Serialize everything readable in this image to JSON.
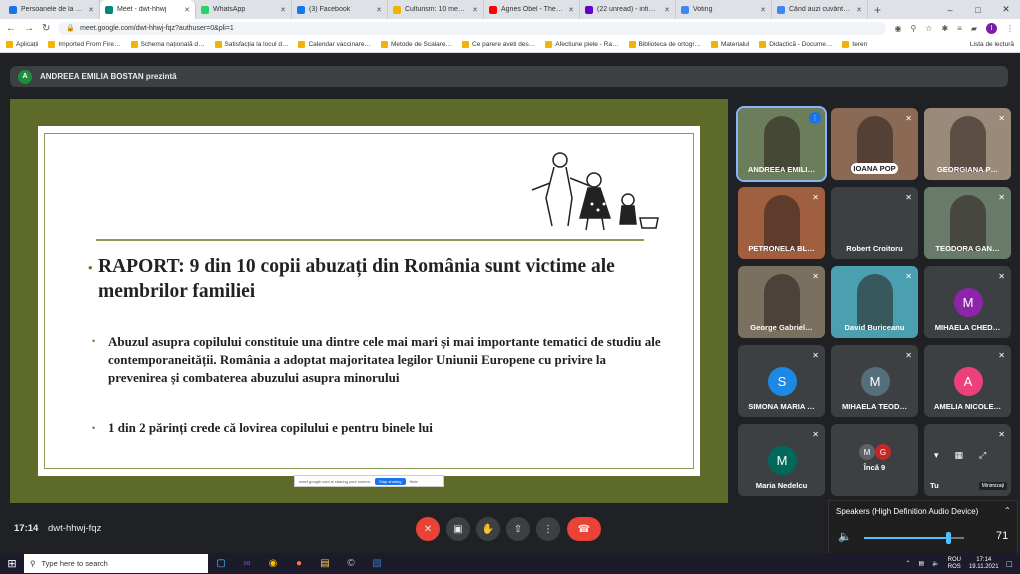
{
  "browser": {
    "tabs": [
      {
        "title": "Persoanele de la EDU…",
        "color": "#1a73e8"
      },
      {
        "title": "Meet - dwt-hhwj",
        "color": "#00897b",
        "active": true
      },
      {
        "title": "WhatsApp",
        "color": "#25d366"
      },
      {
        "title": "(3) Facebook",
        "color": "#1877f2"
      },
      {
        "title": "Culturism: 10 medali…",
        "color": "#f2b400"
      },
      {
        "title": "Agnes Obel - The Cu…",
        "color": "#ff0000"
      },
      {
        "title": "(22 unread) - infimoll…",
        "color": "#6001d2"
      },
      {
        "title": "Voting",
        "color": "#4285f4"
      },
      {
        "title": "Când auzi cuvântul vi…",
        "color": "#4285f4"
      }
    ],
    "url": "meet.google.com/dwt-hhwj-fqz?authuser=0&pli=1",
    "bookmarks": [
      "Aplicații",
      "Imported From Fire…",
      "Schema națională d…",
      "Satisfacția la locul d…",
      "Calendar vaccinare…",
      "Metode de Scalare…",
      "Ce parere aveti des…",
      "Afectiune piele - Ra…",
      "Biblioteca de ortogr…",
      "Materialul",
      "Didactică - Docume…",
      "teren"
    ],
    "reading_list": "Lista de lectură",
    "profile_letter": "I"
  },
  "meet": {
    "presenter_initial": "A",
    "presenter": "ANDREEA EMILIA BOSTAN prezintă",
    "time": "17:14",
    "code": "dwt-hhwj-fqz",
    "sharing_notice": "meet.google.com is sharing your screen.",
    "stop_sharing": "Stop sharing",
    "hide": "Hide"
  },
  "slide": {
    "title": "RAPORT: 9 din 10 copii abuzați din România sunt victime ale membrilor familiei",
    "bullet1": "Abuzul asupra copilului constituie una dintre cele mai mari și mai importante tematici de studiu ale contemporaneității. România a adoptat majoritatea legilor Uniunii Europene cu privire la prevenirea și combaterea abuzului asupra minorului",
    "bullet2": "1 din 2 părinți crede că lovirea copilului e pentru binele lui"
  },
  "participants": [
    {
      "name": "ANDREEA EMILI…",
      "bg": "#6b7d5a",
      "video": true
    },
    {
      "name": "IOANA POP",
      "bg": "#8a6a55",
      "video": true
    },
    {
      "name": "GEORGIANA P…",
      "bg": "#9a8a7a",
      "video": true
    },
    {
      "name": "PETRONELA BL…",
      "bg": "#a06040",
      "video": true
    },
    {
      "name": "Robert Croitoru",
      "bg": "#3c4043",
      "video": false
    },
    {
      "name": "TEODORA GAN…",
      "bg": "#6a7a6a",
      "video": true
    },
    {
      "name": "George Gabriel…",
      "bg": "#7a7060",
      "video": true
    },
    {
      "name": "David Buriceanu",
      "bg": "#4aa0b0",
      "video": true
    },
    {
      "name": "MIHAELA CHED…",
      "initial": "M",
      "avatar": "#8e24aa"
    },
    {
      "name": "SIMONA MARIA …",
      "initial": "S",
      "avatar": "#1e88e5"
    },
    {
      "name": "MIHAELA TEOD…",
      "initial": "M",
      "avatar": "#546e7a"
    },
    {
      "name": "AMELIA NICOLE…",
      "initial": "A",
      "avatar": "#ec407a"
    },
    {
      "name": "Maria Nedelcu",
      "initial": "M",
      "avatar": "#00695c"
    },
    {
      "name": "Încă 9",
      "initials": [
        "M",
        "G"
      ]
    },
    {
      "name": "Tu",
      "extra": "Minimizați"
    }
  ],
  "volume": {
    "device": "Speakers (High Definition Audio Device)",
    "value": "71"
  },
  "taskbar": {
    "search_placeholder": "Type here to search",
    "lang1": "ROU",
    "lang2": "ROS",
    "clock": "17:14",
    "date": "19.11.2021"
  }
}
